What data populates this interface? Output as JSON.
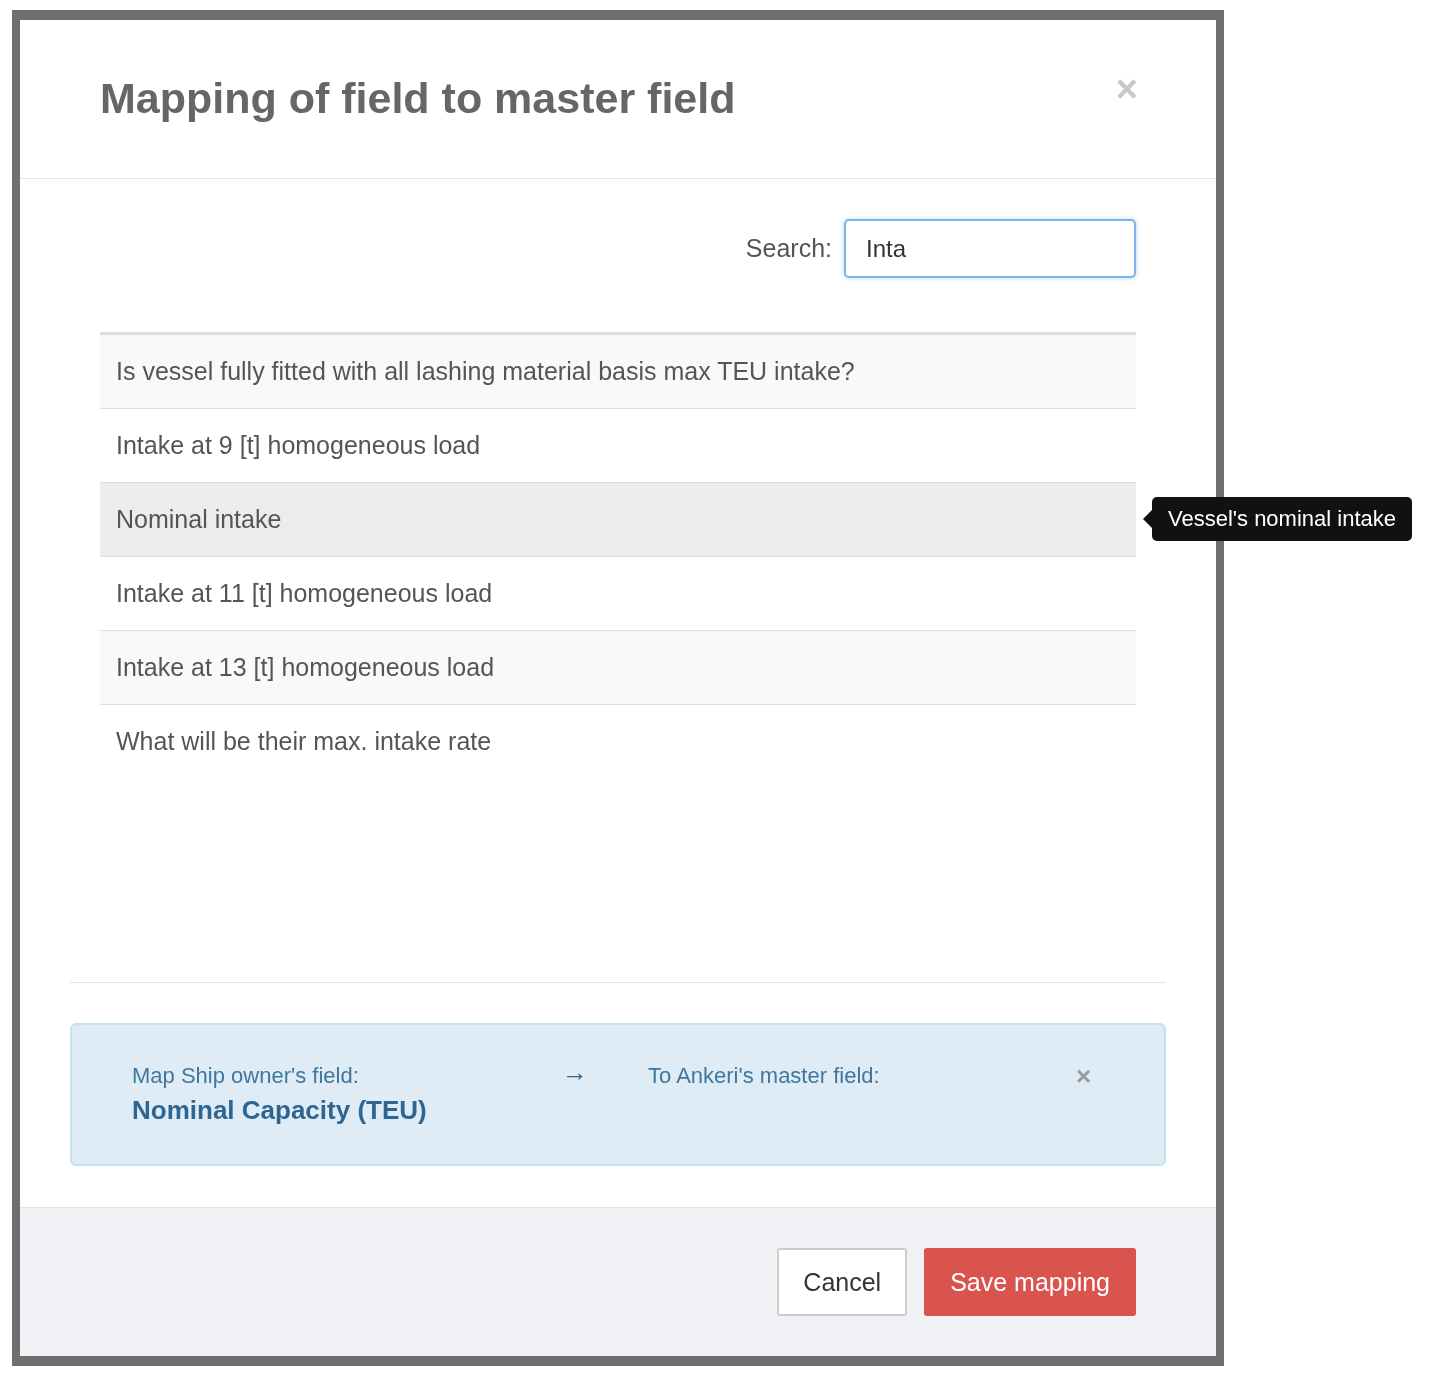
{
  "modal": {
    "title": "Mapping of field to master field",
    "close": "×",
    "search": {
      "label": "Search:",
      "value": "Inta"
    },
    "rows": [
      {
        "text": "Is vessel fully fitted with all lashing material basis max TEU intake?",
        "hovered": false
      },
      {
        "text": "Intake at 9 [t] homogeneous load",
        "hovered": false
      },
      {
        "text": "Nominal intake",
        "hovered": true
      },
      {
        "text": "Intake at 11 [t] homogeneous load",
        "hovered": false
      },
      {
        "text": "Intake at 13 [t] homogeneous load",
        "hovered": false
      },
      {
        "text": "What will be their max. intake rate",
        "hovered": false
      }
    ],
    "tooltip": "Vessel's nominal intake",
    "mapping": {
      "from_label": "Map Ship owner's field:",
      "from_value": "Nominal Capacity (TEU)",
      "arrow": "→",
      "to_label": "To Ankeri's master field:",
      "clear": "×"
    },
    "buttons": [
      {
        "label": "Cancel",
        "kind": "default"
      },
      {
        "label": "Save mapping",
        "kind": "primary"
      }
    ]
  }
}
